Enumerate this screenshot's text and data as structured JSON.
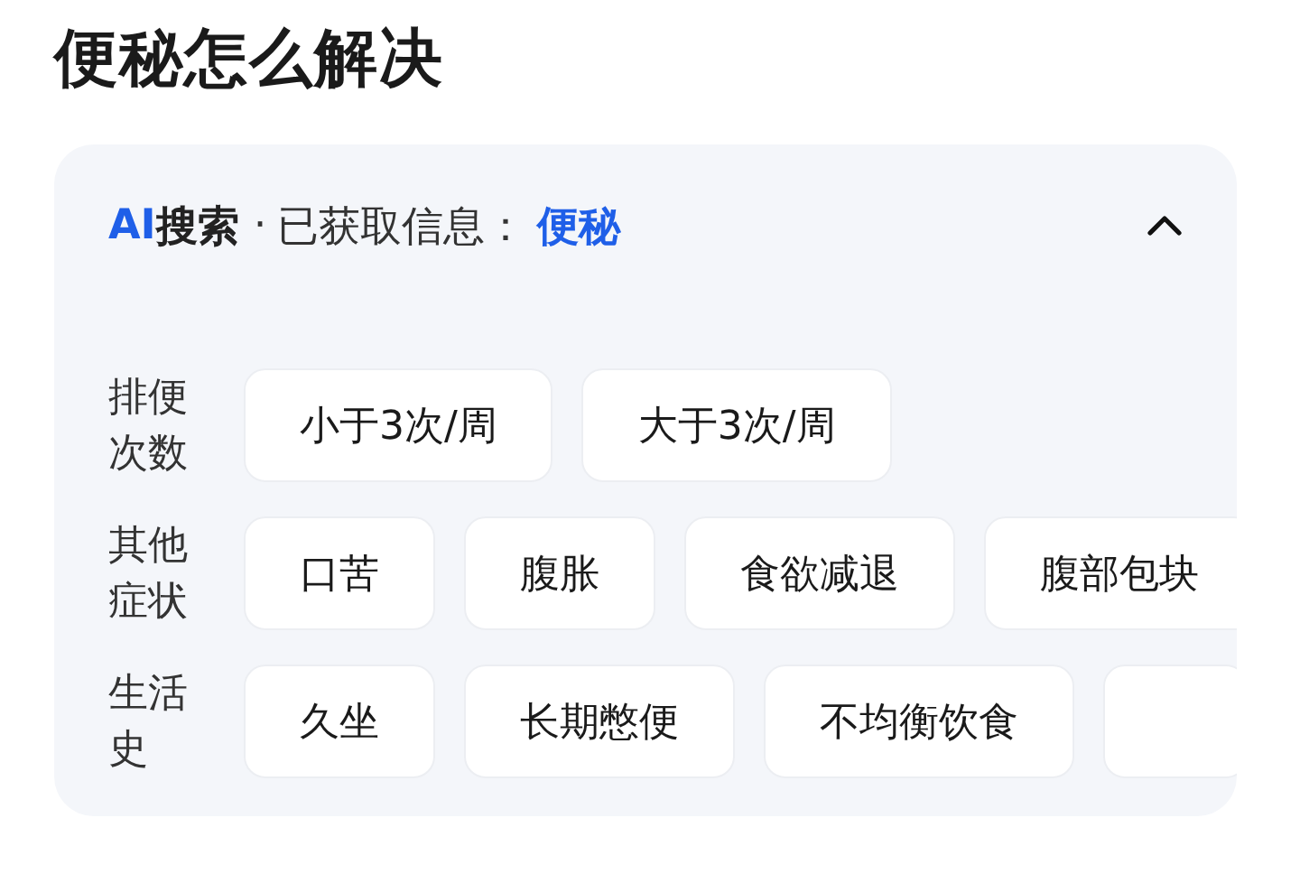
{
  "title": "便秘怎么解决",
  "panel": {
    "brand": "AI",
    "heading": "搜索",
    "separator": "·",
    "info_label": "已获取信息：",
    "keyword": "便秘",
    "expanded": true,
    "rows": [
      {
        "label": "排便次数",
        "options": [
          "小于3次/周",
          "大于3次/周"
        ]
      },
      {
        "label": "其他症状",
        "options": [
          "口苦",
          "腹胀",
          "食欲减退",
          "腹部包块"
        ]
      },
      {
        "label": "生活史",
        "options": [
          "久坐",
          "长期憋便",
          "不均衡饮食"
        ],
        "more_cut_off": true
      }
    ]
  }
}
